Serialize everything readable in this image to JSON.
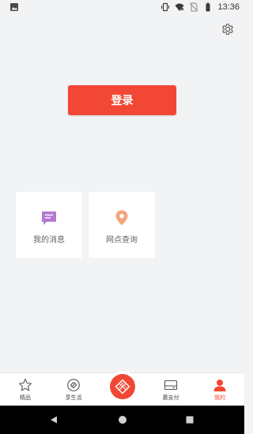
{
  "status_bar": {
    "time": "13:36",
    "left_icon": "image-icon",
    "right_icons": [
      "vibrate-icon",
      "wifi-icon",
      "no-sim-icon",
      "battery-icon"
    ]
  },
  "header": {
    "settings_icon": "gear-icon"
  },
  "login": {
    "label": "登录",
    "color": "#f24734"
  },
  "cards": [
    {
      "label": "我的消息",
      "icon": "message-icon",
      "icon_color": "#b57ad1"
    },
    {
      "label": "网点查询",
      "icon": "location-pin-icon",
      "icon_color": "#f4a37c"
    }
  ],
  "tabs": [
    {
      "label": "精品",
      "icon": "star-icon",
      "active": false
    },
    {
      "label": "享生活",
      "icon": "compass-icon",
      "active": false
    },
    {
      "label": "",
      "icon": "center-diamond-icon",
      "active": false
    },
    {
      "label": "惠支付",
      "icon": "wallet-icon",
      "active": false
    },
    {
      "label": "我的",
      "icon": "user-icon",
      "active": true
    }
  ],
  "nav_bar": {
    "icons": [
      "back-icon",
      "home-icon",
      "recents-icon"
    ]
  },
  "colors": {
    "accent": "#f24734",
    "background": "#f2f3f5"
  }
}
